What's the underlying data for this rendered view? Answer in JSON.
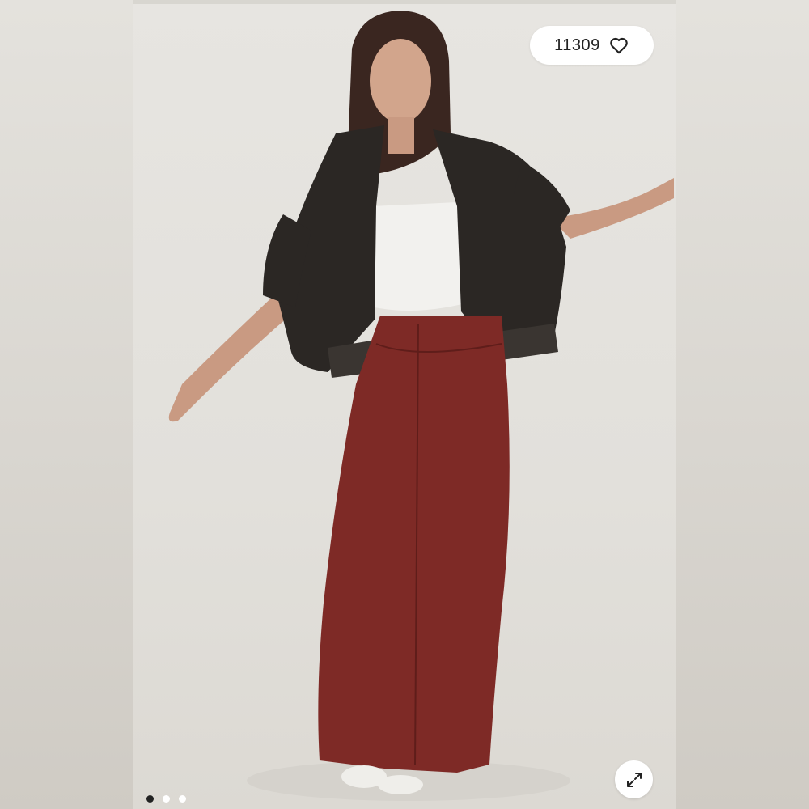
{
  "like_button": {
    "count": "11309",
    "icon": "heart-outline-icon"
  },
  "expand_button": {
    "icon": "expand-arrows-icon"
  },
  "carousel": {
    "total_slides": 3,
    "active_index": 0
  },
  "product_photo": {
    "skirt_color": "#7e2a26",
    "jacket_color": "#2b2724",
    "top_color": "#f2f1ee",
    "background_color": "#e4e2dd"
  }
}
